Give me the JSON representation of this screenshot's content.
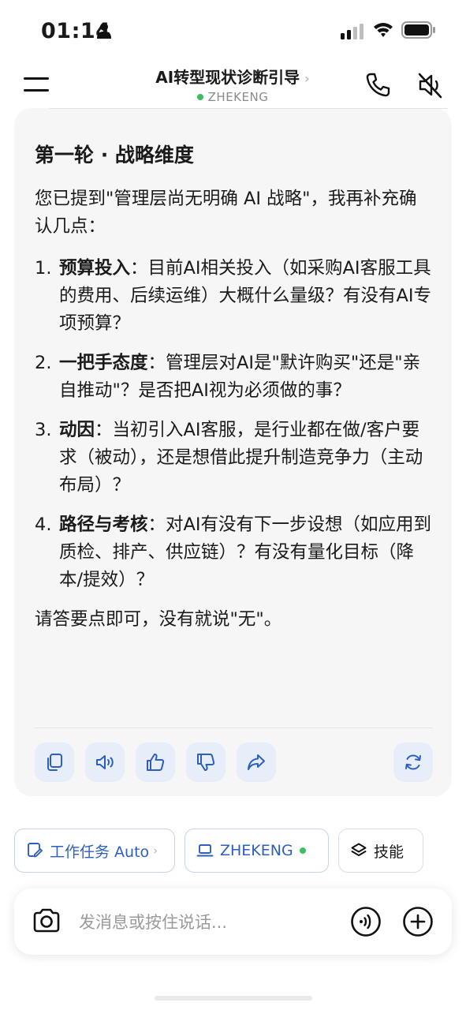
{
  "status_bar": {
    "time": "01:14"
  },
  "header": {
    "title": "AI转型现状诊断引导",
    "title_chevron": "›",
    "agent_name": "ZHEKENG",
    "status_color": "#3cbf5d"
  },
  "message": {
    "heading": "第一轮 · 战略维度",
    "intro": "您已提到\"管理层尚无明确 AI 战略\"，我再补充确认几点：",
    "items": [
      {
        "num": "1.",
        "title": "预算投入",
        "text": "：目前AI相关投入（如采购AI客服工具的费用、后续运维）大概什么量级？有没有AI专项预算？"
      },
      {
        "num": "2.",
        "title": "一把手态度",
        "text": "：管理层对AI是\"默许购买\"还是\"亲自推动\"？是否把AI视为必须做的事？"
      },
      {
        "num": "3.",
        "title": "动因",
        "text": "：当初引入AI客服，是行业都在做/客户要求（被动），还是想借此提升制造竞争力（主动布局）？"
      },
      {
        "num": "4.",
        "title": "路径与考核",
        "text": "：对AI有没有下一步设想（如应用到质检、排产、供应链）？有没有量化目标（降本/提效）？"
      }
    ],
    "closing": "请答要点即可，没有就说\"无\"。",
    "actions": [
      "copy-icon",
      "speaker-icon",
      "thumbs-up-icon",
      "thumbs-down-icon",
      "share-icon",
      "regenerate-icon"
    ]
  },
  "chips": {
    "task_label": "工作任务 Auto",
    "task_chevron": "›",
    "device_label": "ZHEKENG",
    "skill_label": "技能",
    "accent_color": "#2d5fc0"
  },
  "composer": {
    "placeholder": "发消息或按住说话..."
  }
}
